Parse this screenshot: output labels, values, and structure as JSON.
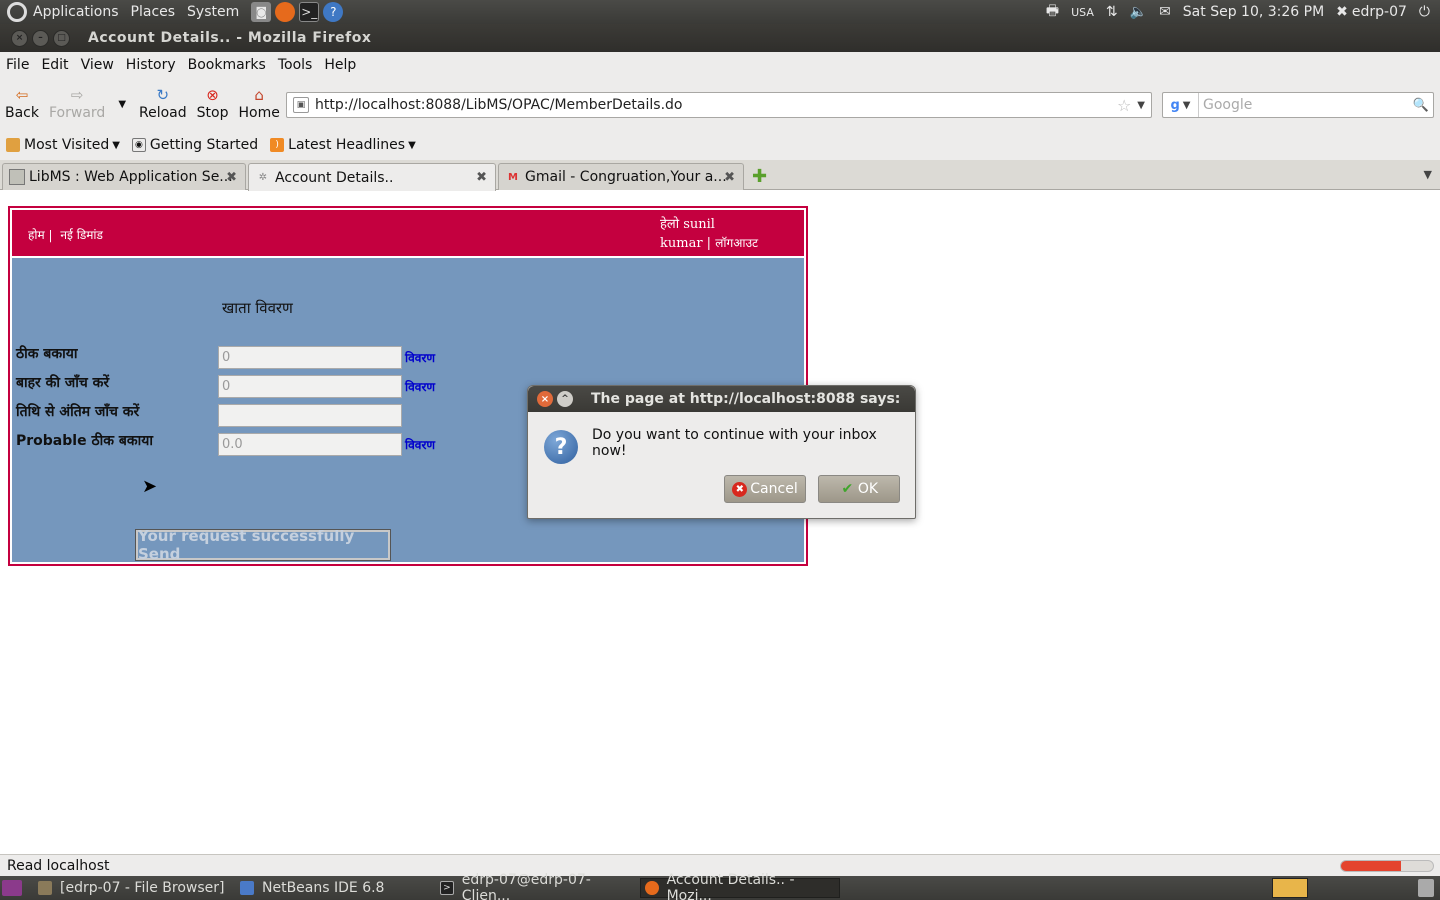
{
  "top_panel": {
    "menus": [
      "Applications",
      "Places",
      "System"
    ],
    "keyboard": "USA",
    "clock": "Sat Sep 10,  3:26 PM",
    "user": "edrp-07"
  },
  "window": {
    "title": "Account Details.. - Mozilla Firefox"
  },
  "menubar": {
    "items": [
      "File",
      "Edit",
      "View",
      "History",
      "Bookmarks",
      "Tools",
      "Help"
    ]
  },
  "navbar": {
    "back": "Back",
    "forward": "Forward",
    "reload": "Reload",
    "stop": "Stop",
    "home": "Home",
    "url": "http://localhost:8088/LibMS/OPAC/MemberDetails.do",
    "search_placeholder": "Google"
  },
  "bookmarks": {
    "items": [
      "Most Visited",
      "Getting Started",
      "Latest Headlines"
    ]
  },
  "tabs": [
    {
      "label": "LibMS : Web Application Se..."
    },
    {
      "label": "Account Details.."
    },
    {
      "label": "Gmail - Congruation,Your a..."
    }
  ],
  "libms": {
    "nav_home": "होम |",
    "nav_demand": "नई डिमांड",
    "greeting_line1": "हेलो sunil",
    "greeting_line2": "kumar |",
    "logout": "लॉगआउट",
    "section_title": "खाता विवरण",
    "rows": [
      {
        "label": "ठीक बकाया",
        "value": "0",
        "link": "विवरण"
      },
      {
        "label": "बाहर की जाँच करें",
        "value": "0",
        "link": "विवरण"
      },
      {
        "label": "तिथि से अंतिम जाँच करें",
        "value": "",
        "link": ""
      },
      {
        "label": "Probable ठीक बकाया",
        "value": "0.0",
        "link": "विवरण"
      }
    ],
    "send_button": "Your request successfully Send"
  },
  "dialog": {
    "title": "The page at http://localhost:8088 says:",
    "message": "Do you want to continue with your inbox now!",
    "cancel": "Cancel",
    "ok": "OK"
  },
  "statusbar": {
    "text": "Read localhost"
  },
  "taskbar": {
    "items": [
      "[edrp-07 - File Browser]",
      "NetBeans IDE 6.8",
      "edrp-07@edrp-07-Clien...",
      "Account Details.. - Mozi..."
    ]
  }
}
